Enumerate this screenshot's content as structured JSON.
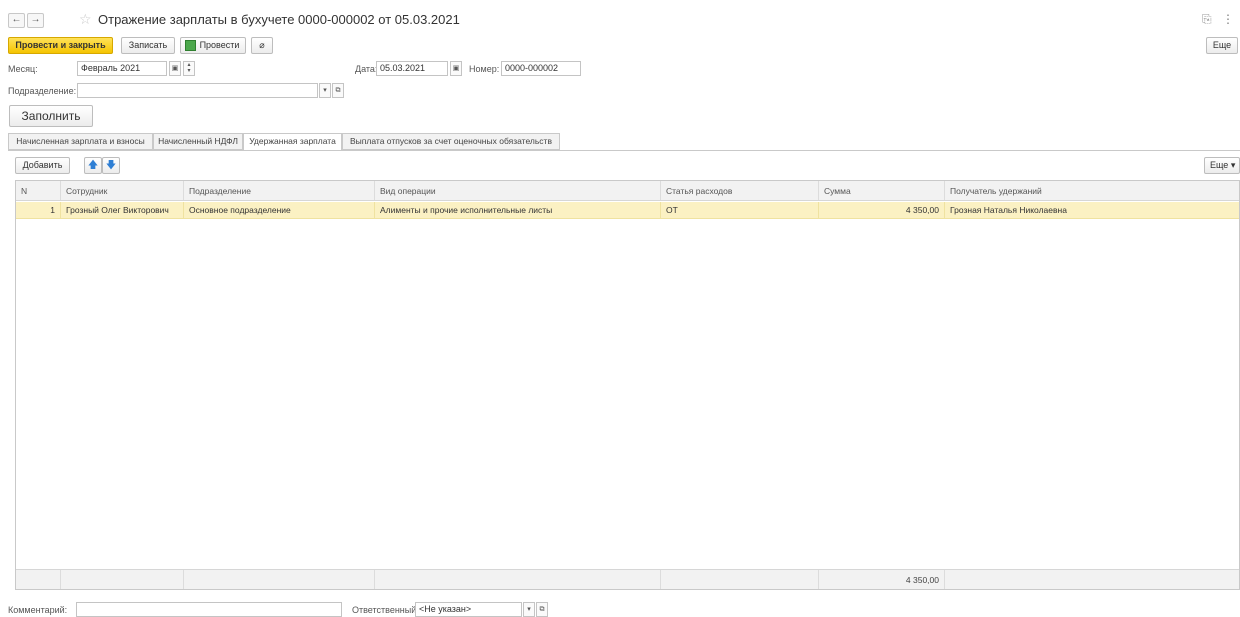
{
  "window": {
    "title": "Отражение зарплаты в бухучете 0000-000002 от 05.03.2021",
    "back_glyph": "←",
    "forward_glyph": "→",
    "star_glyph": "☆",
    "link_glyph": "⎘",
    "menu_glyph": "⋮"
  },
  "toolbar": {
    "post_and_close": "Провести и закрыть",
    "save": "Записать",
    "post": "Провести",
    "attach_glyph": "⌀",
    "more": "Еще"
  },
  "form": {
    "month_label": "Месяц:",
    "month_value": "Февраль 2021",
    "date_label": "Дата:",
    "date_value": "05.03.2021",
    "number_label": "Номер:",
    "number_value": "0000-000002",
    "division_label": "Подразделение:",
    "division_value": "",
    "fill_button": "Заполнить"
  },
  "tabs": [
    {
      "label": "Начисленная зарплата и взносы"
    },
    {
      "label": "Начисленный НДФЛ"
    },
    {
      "label": "Удержанная зарплата"
    },
    {
      "label": "Выплата отпусков за счет оценочных обязательств"
    }
  ],
  "active_tab": "Удержанная зарплата",
  "table_toolbar": {
    "add": "Добавить",
    "up_glyph": "🡅",
    "down_glyph": "🡇",
    "more": "Еще ▾"
  },
  "table": {
    "columns": [
      "N",
      "Сотрудник",
      "Подразделение",
      "Вид операции",
      "Статья расходов",
      "Сумма",
      "Получатель удержаний"
    ],
    "rows": [
      {
        "n": "1",
        "employee": "Грозный Олег Викторович",
        "division": "Основное подразделение",
        "operation": "Алименты и прочие исполнительные листы",
        "expense_item": "ОТ",
        "amount": "4 350,00",
        "recipient": "Грозная Наталья Николаевна"
      }
    ],
    "total_amount": "4 350,00"
  },
  "footer": {
    "comment_label": "Комментарий:",
    "comment_value": "",
    "responsible_label": "Ответственный:",
    "responsible_value": "<Не указан>"
  }
}
